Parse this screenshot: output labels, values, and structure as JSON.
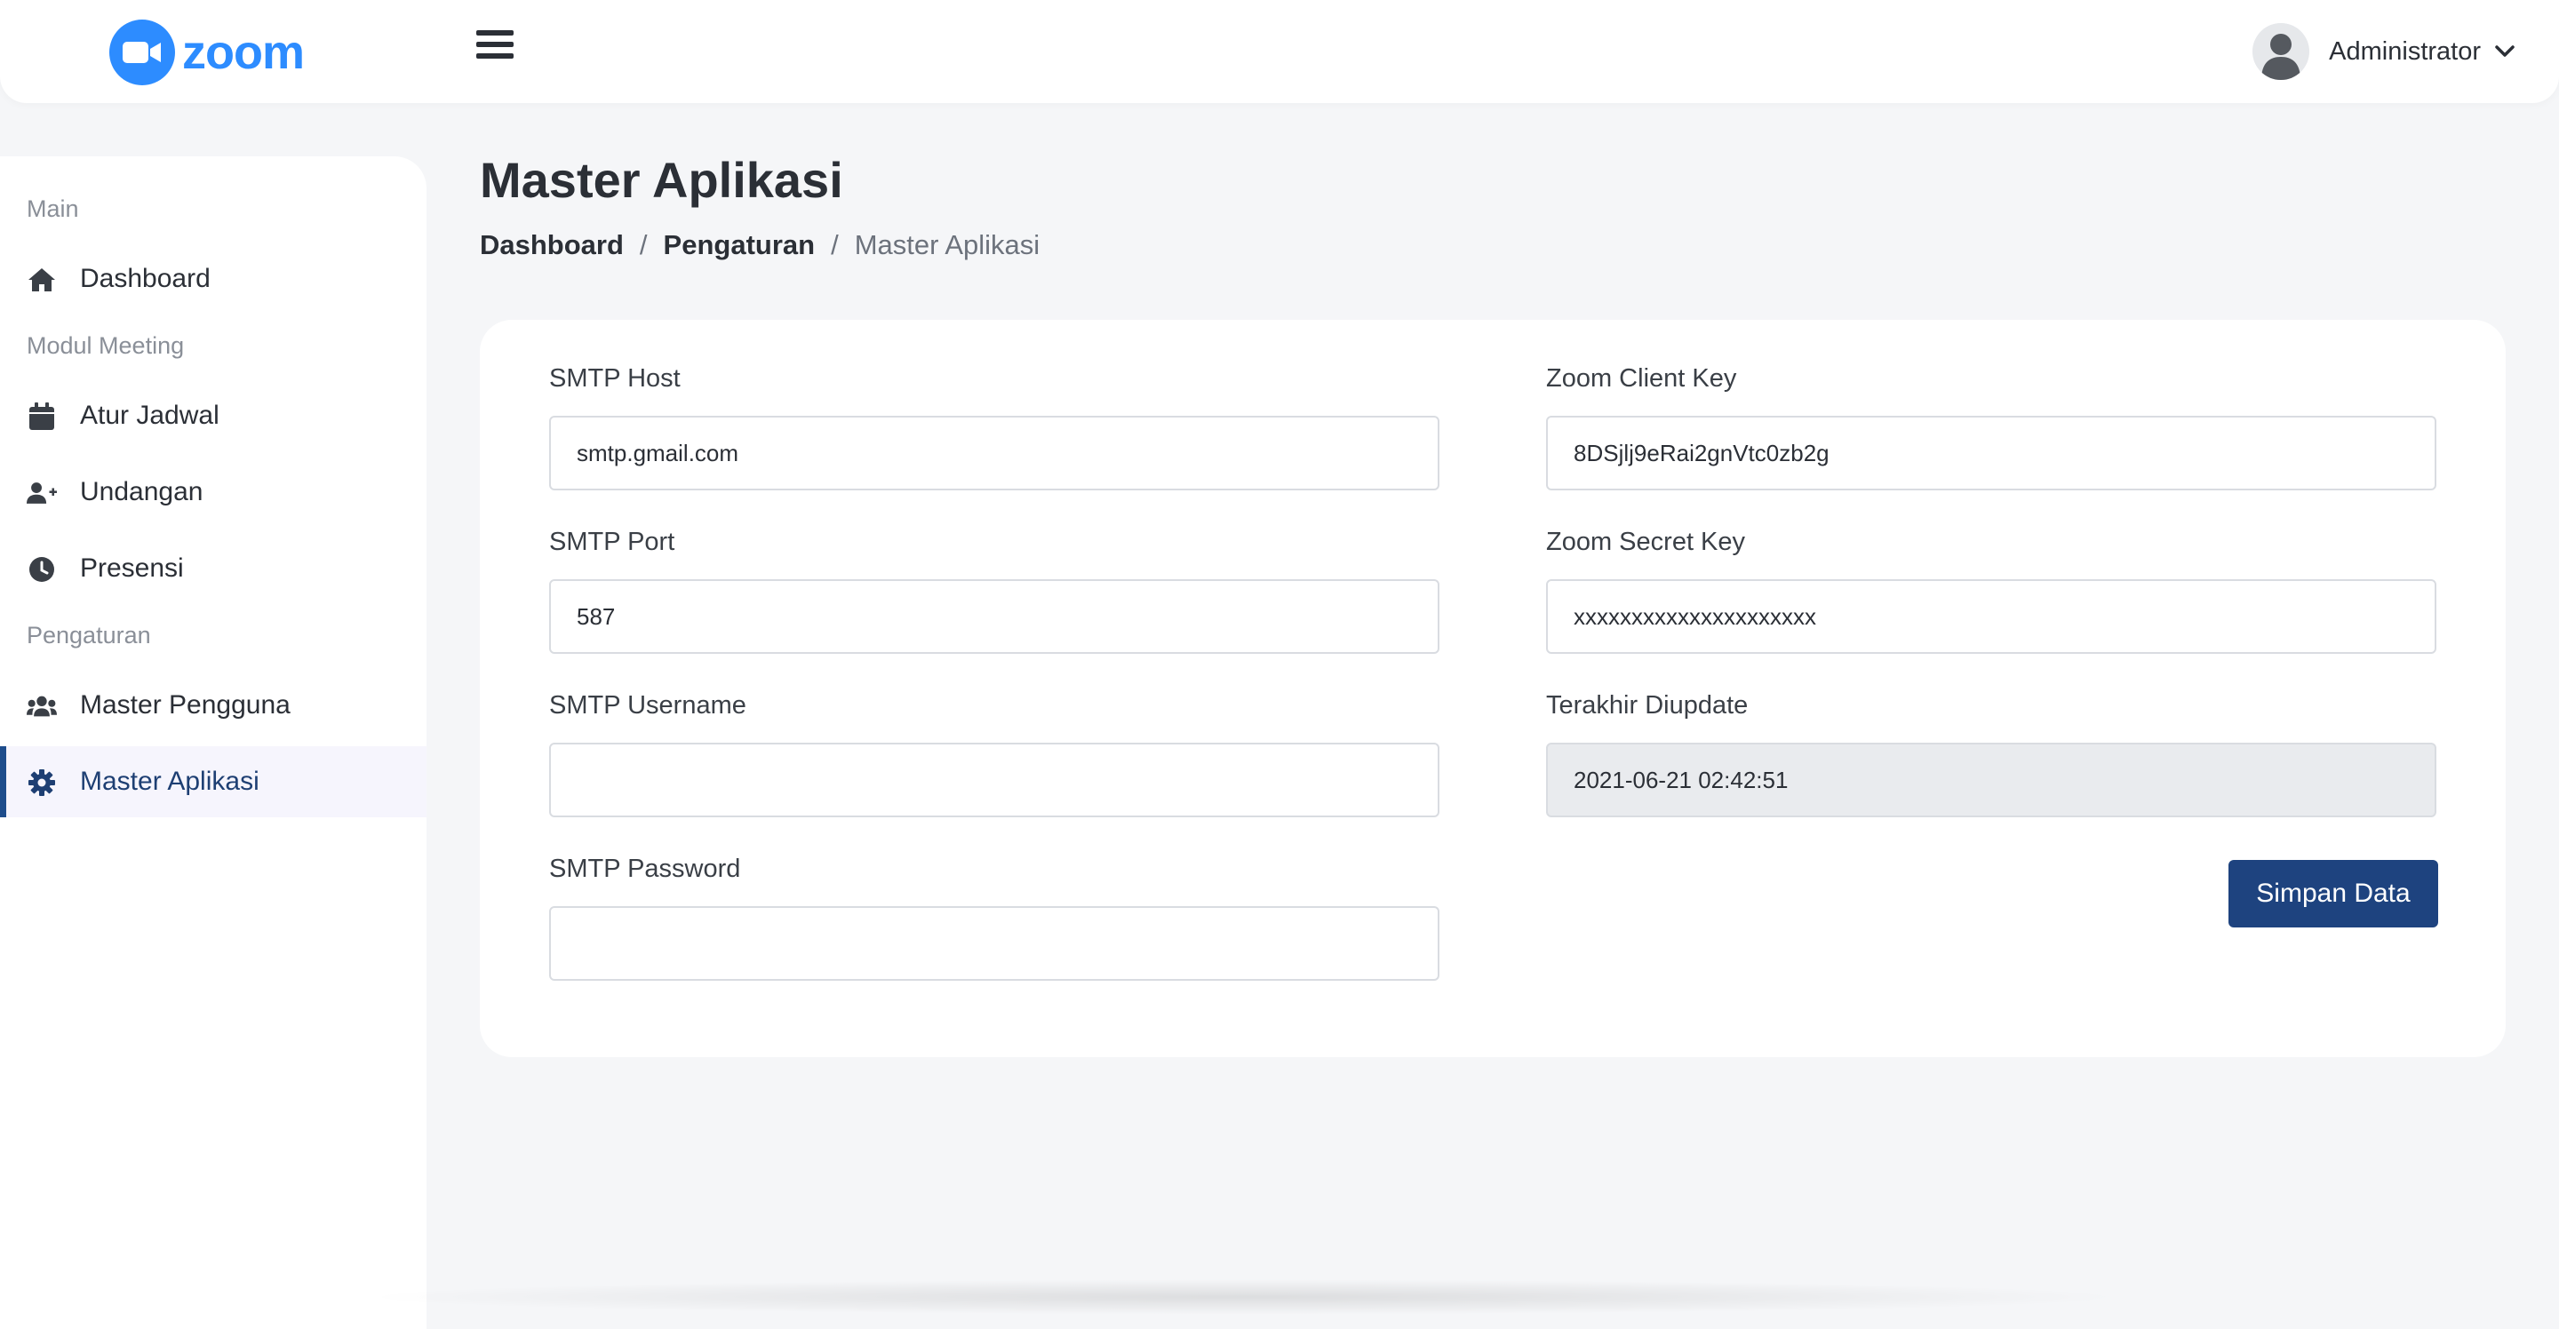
{
  "header": {
    "logo_text": "zoom",
    "user_name": "Administrator"
  },
  "sidebar": {
    "sections": [
      {
        "label": "Main"
      },
      {
        "label": "Modul Meeting"
      },
      {
        "label": "Pengaturan"
      }
    ],
    "items": [
      {
        "label": "Dashboard",
        "icon": "home-icon"
      },
      {
        "label": "Atur Jadwal",
        "icon": "calendar-icon"
      },
      {
        "label": "Undangan",
        "icon": "user-plus-icon"
      },
      {
        "label": "Presensi",
        "icon": "clock-icon"
      },
      {
        "label": "Master Pengguna",
        "icon": "users-icon"
      },
      {
        "label": "Master Aplikasi",
        "icon": "gear-icon",
        "active": true
      }
    ]
  },
  "page": {
    "title": "Master Aplikasi",
    "breadcrumb": [
      "Dashboard",
      "Pengaturan",
      "Master Aplikasi"
    ],
    "breadcrumb_separator": "/"
  },
  "form": {
    "smtp_host": {
      "label": "SMTP Host",
      "value": "smtp.gmail.com"
    },
    "smtp_port": {
      "label": "SMTP Port",
      "value": "587"
    },
    "smtp_username": {
      "label": "SMTP Username",
      "value": ""
    },
    "smtp_password": {
      "label": "SMTP Password",
      "value": ""
    },
    "zoom_client_key": {
      "label": "Zoom Client Key",
      "value": "8DSjlj9eRai2gnVtc0zb2g"
    },
    "zoom_secret_key": {
      "label": "Zoom Secret Key",
      "value": "xxxxxxxxxxxxxxxxxxxxx"
    },
    "last_updated": {
      "label": "Terakhir Diupdate",
      "value": "2021-06-21 02:42:51"
    },
    "save_label": "Simpan Data"
  },
  "colors": {
    "brand": "#2d8cff",
    "primary": "#1e437f",
    "background": "#f5f6f8"
  }
}
